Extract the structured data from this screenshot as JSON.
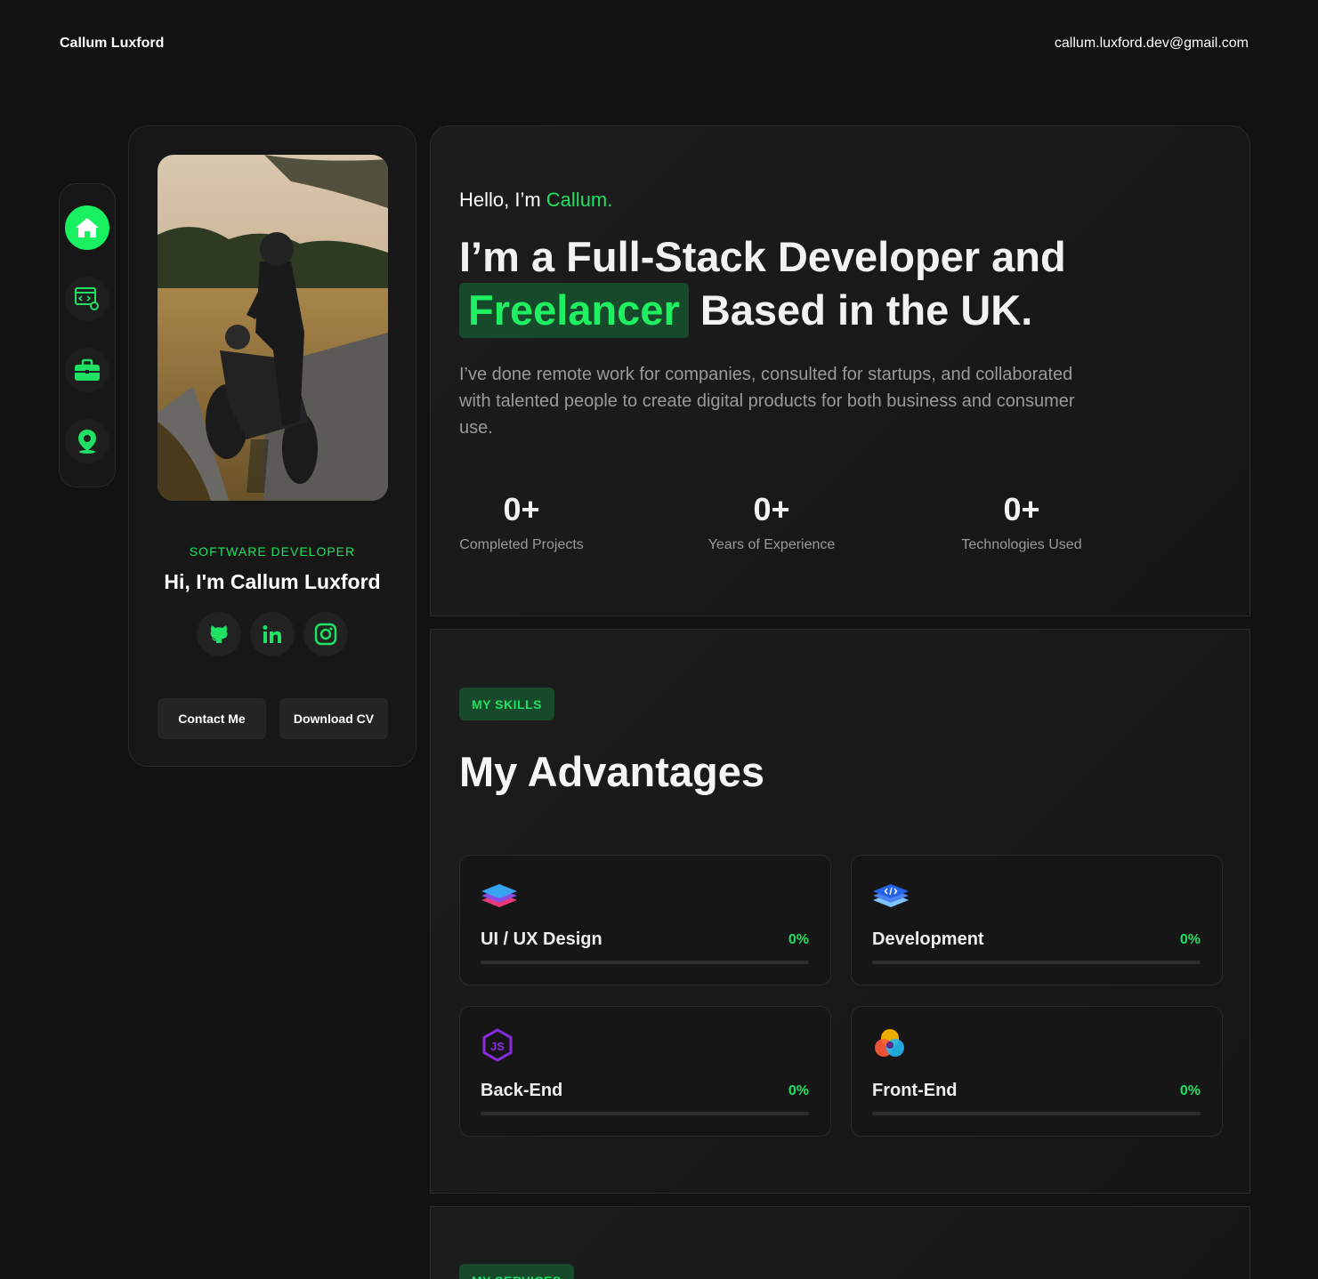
{
  "header": {
    "name": "Callum Luxford",
    "email": "callum.luxford.dev@gmail.com"
  },
  "sidenav": {
    "items": [
      {
        "icon": "home-icon",
        "active": true
      },
      {
        "icon": "code-settings-icon",
        "active": false
      },
      {
        "icon": "briefcase-icon",
        "active": false
      },
      {
        "icon": "location-pin-icon",
        "active": false
      }
    ]
  },
  "profile": {
    "role": "SOFTWARE DEVELOPER",
    "greeting": "Hi, I'm Callum Luxford",
    "socials": [
      "github-icon",
      "linkedin-icon",
      "instagram-icon"
    ],
    "contact_label": "Contact Me",
    "cv_label": "Download CV"
  },
  "hero": {
    "hello_prefix": "Hello, I’m ",
    "hello_name": "Callum.",
    "headline_line1": "I’m a Full-Stack Developer and",
    "headline_highlight": "Freelancer",
    "headline_rest": "Based in the UK.",
    "intro": "I’ve done remote work for companies, consulted for startups, and collaborated with talented people to create digital products for both business and consumer use.",
    "stats": [
      {
        "value": "0+",
        "label": "Completed Projects"
      },
      {
        "value": "0+",
        "label": "Years of Experience"
      },
      {
        "value": "0+",
        "label": "Technologies Used"
      }
    ]
  },
  "skills": {
    "tag": "MY SKILLS",
    "title": "My Advantages",
    "items": [
      {
        "name": "UI / UX Design",
        "percent": "0%",
        "level": 0,
        "icon": "layers-icon"
      },
      {
        "name": "Development",
        "percent": "0%",
        "level": 0,
        "icon": "code-layers-icon"
      },
      {
        "name": "Back-End",
        "percent": "0%",
        "level": 0,
        "icon": "nodejs-icon"
      },
      {
        "name": "Front-End",
        "percent": "0%",
        "level": 0,
        "icon": "color-circles-icon"
      }
    ]
  },
  "services": {
    "tag": "MY SERVICES"
  },
  "colors": {
    "background": "#121212",
    "accent": "#1fe163",
    "accent_bg": "#174a2a"
  }
}
